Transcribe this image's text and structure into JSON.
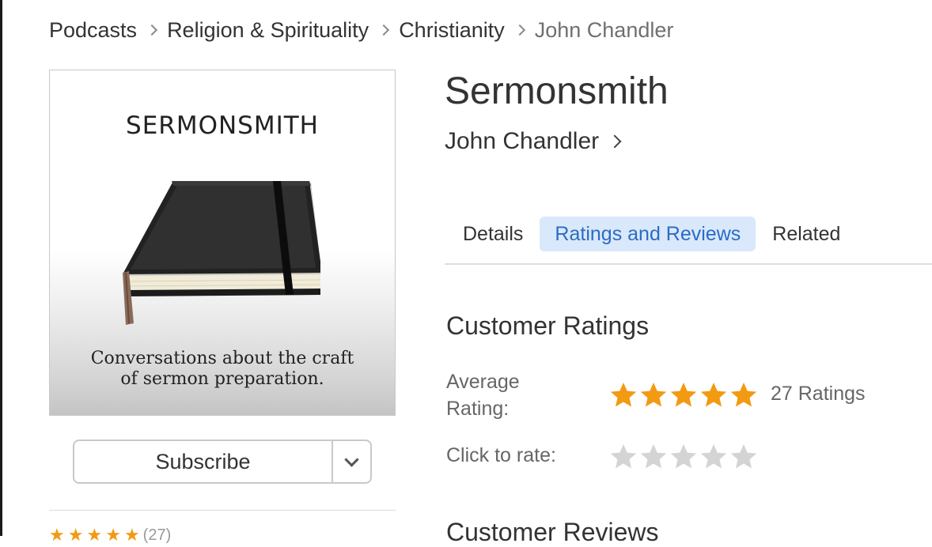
{
  "breadcrumb": {
    "items": [
      "Podcasts",
      "Religion & Spirituality",
      "Christianity"
    ],
    "current": "John Chandler"
  },
  "artwork": {
    "title": "SERMONSMITH",
    "caption_line1": "Conversations about the craft",
    "caption_line2": "of sermon preparation."
  },
  "subscribe": {
    "label": "Subscribe"
  },
  "mini_rating": {
    "count": "(27)"
  },
  "podcast": {
    "title": "Sermonsmith",
    "artist": "John Chandler"
  },
  "tabs": [
    {
      "label": "Details",
      "active": false
    },
    {
      "label": "Ratings and Reviews",
      "active": true
    },
    {
      "label": "Related",
      "active": false
    }
  ],
  "ratings": {
    "section_title": "Customer Ratings",
    "average_label": "Average Rating:",
    "average_stars": 5,
    "count_text": "27 Ratings",
    "rate_label": "Click to rate:"
  },
  "reviews": {
    "section_title": "Customer Reviews"
  },
  "colors": {
    "star_filled": "#f29a12",
    "star_empty": "#d4d4d4",
    "tab_active_bg": "#d9e8fa",
    "tab_active_text": "#2b6cc4"
  },
  "icons": [
    "chevron-right-icon",
    "chevron-down-icon",
    "star-icon",
    "notebook-illustration"
  ]
}
